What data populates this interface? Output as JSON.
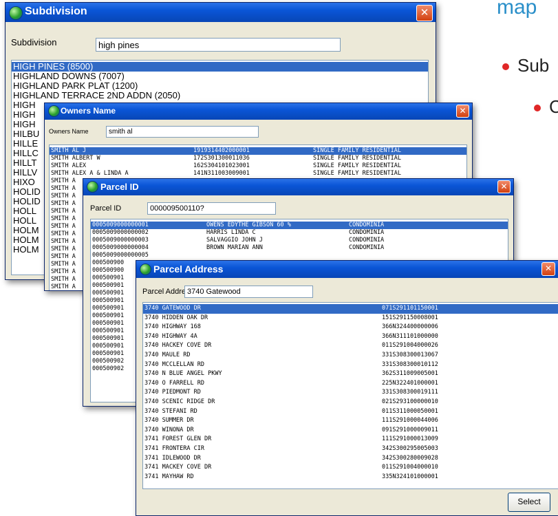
{
  "slide": {
    "title": "map",
    "bullets": [
      "Sub",
      "C"
    ],
    "bullet_color": "#e02727",
    "title_color": "#2a8fc9"
  },
  "subdivision": {
    "title": "Subdivision",
    "close": "✕",
    "label": "Subdivision",
    "value": "high pines",
    "items": [
      "HIGH PINES (8500)",
      "HIGHLAND DOWNS (7007)",
      "HIGHLAND PARK PLAT (1200)",
      "HIGHLAND TERRACE 2ND ADDN (2050)",
      "HIGH",
      "HIGH",
      "HIGH",
      "HILBU",
      "HILLE",
      "HILLC",
      "HILLT",
      "HILLV",
      "HIXO",
      "HOLID",
      "HOLID",
      "HOLL",
      "HOLL",
      "HOLM",
      "HOLM",
      "HOLM"
    ]
  },
  "owners": {
    "title": "Owners Name",
    "close": "✕",
    "label": "Owners Name",
    "value": "smith al",
    "rows": [
      {
        "name": "SMITH AL J",
        "id": "1919314402000001",
        "type": "SINGLE FAMILY RESIDENTIAL"
      },
      {
        "name": "SMITH ALBERT W",
        "id": "172S301300011036",
        "type": "SINGLE FAMILY RESIDENTIAL"
      },
      {
        "name": "SMITH ALEX",
        "id": "162S304101023001",
        "type": "SINGLE FAMILY RESIDENTIAL"
      },
      {
        "name": "SMITH ALEX A & LINDA A",
        "id": "141N311003009001",
        "type": "SINGLE FAMILY RESIDENTIAL"
      },
      {
        "name": "SMITH A",
        "id": "",
        "type": ""
      },
      {
        "name": "SMITH A",
        "id": "",
        "type": ""
      },
      {
        "name": "SMITH A",
        "id": "",
        "type": ""
      },
      {
        "name": "SMITH A",
        "id": "",
        "type": ""
      },
      {
        "name": "SMITH A",
        "id": "",
        "type": ""
      },
      {
        "name": "SMITH A",
        "id": "",
        "type": ""
      },
      {
        "name": "SMITH A",
        "id": "",
        "type": ""
      },
      {
        "name": "SMITH A",
        "id": "",
        "type": ""
      },
      {
        "name": "SMITH A",
        "id": "",
        "type": ""
      },
      {
        "name": "SMITH A",
        "id": "",
        "type": ""
      },
      {
        "name": "SMITH A",
        "id": "",
        "type": ""
      },
      {
        "name": "SMITH A",
        "id": "",
        "type": ""
      },
      {
        "name": "SMITH A",
        "id": "",
        "type": ""
      },
      {
        "name": "SMITH A",
        "id": "",
        "type": ""
      },
      {
        "name": "SMITH A",
        "id": "",
        "type": ""
      },
      {
        "name": "SMITH A",
        "id": "",
        "type": ""
      },
      {
        "name": "SMITH A",
        "id": "",
        "type": ""
      },
      {
        "name": "SMITH A",
        "id": "",
        "type": ""
      }
    ]
  },
  "parcel": {
    "title": "Parcel ID",
    "close": "✕",
    "label": "Parcel ID",
    "value": "000009500110?",
    "rows": [
      {
        "id": "0005009000000001",
        "owner": "OWENS EDYTHE GIBSON 60 %",
        "type": "CONDOMINIA"
      },
      {
        "id": "0005009000000002",
        "owner": "HARRIS LINDA C",
        "type": "CONDOMINIA"
      },
      {
        "id": "0005009000000003",
        "owner": "SALVAGGIO JOHN J",
        "type": "CONDOMINIA"
      },
      {
        "id": "0005009000000004",
        "owner": "BROWN MARIAN ANN",
        "type": "CONDOMINIA"
      },
      {
        "id": "0005009000000005",
        "owner": "",
        "type": ""
      },
      {
        "id": "000500900",
        "owner": "",
        "type": ""
      },
      {
        "id": "000500900",
        "owner": "",
        "type": ""
      },
      {
        "id": "000500901",
        "owner": "",
        "type": ""
      },
      {
        "id": "000500901",
        "owner": "",
        "type": ""
      },
      {
        "id": "000500901",
        "owner": "",
        "type": ""
      },
      {
        "id": "000500901",
        "owner": "",
        "type": ""
      },
      {
        "id": "000500901",
        "owner": "",
        "type": ""
      },
      {
        "id": "000500901",
        "owner": "",
        "type": ""
      },
      {
        "id": "000500901",
        "owner": "",
        "type": ""
      },
      {
        "id": "000500901",
        "owner": "",
        "type": ""
      },
      {
        "id": "000500901",
        "owner": "",
        "type": ""
      },
      {
        "id": "000500901",
        "owner": "",
        "type": ""
      },
      {
        "id": "000500901",
        "owner": "",
        "type": ""
      },
      {
        "id": "000500902",
        "owner": "",
        "type": ""
      },
      {
        "id": "000500902",
        "owner": "",
        "type": ""
      }
    ]
  },
  "address": {
    "title": "Parcel Address",
    "close": "✕",
    "label": "Parcel Address",
    "value": "3740 Gatewood",
    "select_label": "Select",
    "rows": [
      {
        "addr": "3740 GATEWOOD DR",
        "id": "071S291101150001"
      },
      {
        "addr": "3740 HIDDEN OAK DR",
        "id": "151S291150008001"
      },
      {
        "addr": "3740 HIGHWAY 168",
        "id": "366N324400000006"
      },
      {
        "addr": "3740 HIGHWAY 4A",
        "id": "366N311101000000"
      },
      {
        "addr": "3740 HACKEY COVE DR",
        "id": "011S291004000026"
      },
      {
        "addr": "3740 MAULE RD",
        "id": "331S308300013067"
      },
      {
        "addr": "3740 MCCLELLAN RD",
        "id": "331S308300010112"
      },
      {
        "addr": "3740 N BLUE ANGEL PKWY",
        "id": "362S311009005001"
      },
      {
        "addr": "3740 O FARRELL RD",
        "id": "225N322401000001"
      },
      {
        "addr": "3740 PIEDMONT RD",
        "id": "331S308300019111"
      },
      {
        "addr": "3740 SCENIC RIDGE DR",
        "id": "021S293100000010"
      },
      {
        "addr": "3740 STEFANI RD",
        "id": "011S311000050001"
      },
      {
        "addr": "3740 SUMMER DR",
        "id": "111S291000044006"
      },
      {
        "addr": "3740 WINONA DR",
        "id": "091S291000009011"
      },
      {
        "addr": "3741 FOREST GLEN DR",
        "id": "111S291000013009"
      },
      {
        "addr": "3741 FRONTERA CIR",
        "id": "342S300295005003"
      },
      {
        "addr": "3741 IDLEWOOD DR",
        "id": "342S300280009028"
      },
      {
        "addr": "3741 MACKEY COVE DR",
        "id": "011S291004000010"
      },
      {
        "addr": "3741 MAYHAW RD",
        "id": "335N324101000001"
      }
    ]
  }
}
